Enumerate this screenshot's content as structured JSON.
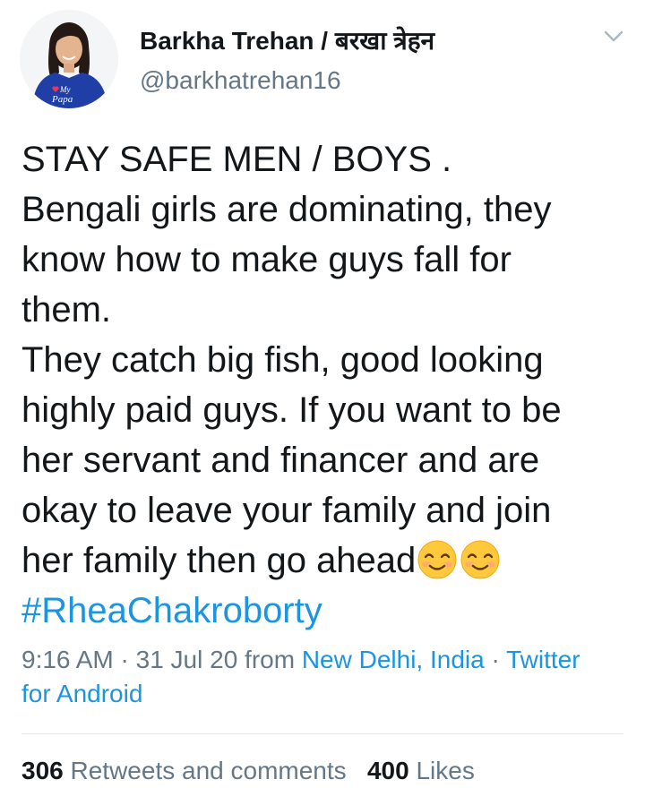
{
  "author": {
    "display_name": "Barkha Trehan / बरखा त्रेहन",
    "handle": "@barkhatrehan16",
    "avatar_shirt_text_1": "My",
    "avatar_shirt_text_2": "Papa"
  },
  "tweet": {
    "lines": [
      "STAY SAFE MEN / BOYS .",
      "Bengali girls are dominating, they",
      "know how to make guys fall for",
      "them.",
      "They catch big fish, good looking",
      "highly paid guys. If you want to be",
      "her servant and financer and are",
      "okay to leave your family and join",
      "her family then go ahead"
    ],
    "emojis": [
      "smiling-face-icon",
      "smiling-face-icon"
    ],
    "hashtag": "#RheaChakroborty"
  },
  "meta": {
    "time": "9:16 AM",
    "separator": "·",
    "date": "31 Jul 20",
    "from_label": "from",
    "location": "New Delhi, India",
    "source_part1": "Twitter",
    "source_part2": "for Android"
  },
  "stats": {
    "retweets_count": "306",
    "retweets_label": "Retweets and comments",
    "likes_count": "400",
    "likes_label": "Likes"
  },
  "colors": {
    "link": "#1b95e0",
    "secondary_text": "#657786",
    "primary_text": "#14171a",
    "divider": "#e1e8ed"
  }
}
